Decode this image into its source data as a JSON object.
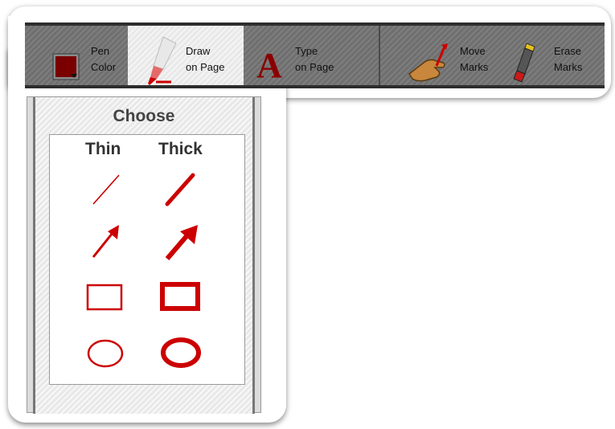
{
  "toolbar": {
    "pen_color": {
      "line1": "Pen",
      "line2": "Color",
      "swatch_color": "#7a0000",
      "icon": "color-swatch-icon"
    },
    "draw_on_page": {
      "line1": "Draw",
      "line2": "on Page",
      "icon": "marker-icon",
      "selected": true
    },
    "type_on_page": {
      "line1": "Type",
      "line2": "on Page",
      "icon": "letter-a-icon"
    },
    "move_marks": {
      "line1": "Move",
      "line2": "Marks",
      "icon": "hand-move-icon"
    },
    "erase_marks": {
      "line1": "Erase",
      "line2": "Marks",
      "icon": "eraser-icon"
    }
  },
  "choose_panel": {
    "title": "Choose",
    "columns": {
      "thin": "Thin",
      "thick": "Thick"
    },
    "options": [
      {
        "shape": "line-icon",
        "variant": "thin"
      },
      {
        "shape": "line-icon",
        "variant": "thick"
      },
      {
        "shape": "arrow-icon",
        "variant": "thin"
      },
      {
        "shape": "arrow-icon",
        "variant": "thick"
      },
      {
        "shape": "rectangle-icon",
        "variant": "thin"
      },
      {
        "shape": "rectangle-icon",
        "variant": "thick"
      },
      {
        "shape": "ellipse-icon",
        "variant": "thin"
      },
      {
        "shape": "ellipse-icon",
        "variant": "thick"
      }
    ]
  },
  "colors": {
    "accent_red": "#cc0000",
    "toolbar_gray": "#6f6f6f"
  }
}
